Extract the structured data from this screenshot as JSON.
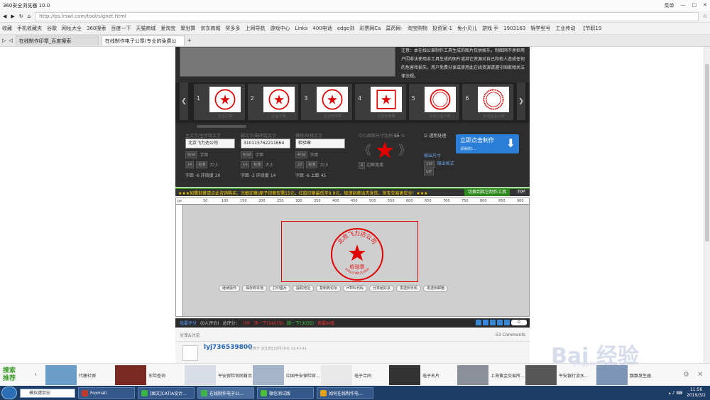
{
  "window": {
    "title": "360安全浏览器 10.0",
    "controls": [
      "菜单"
    ]
  },
  "address": {
    "url": "http://ps.lrswl.com/tool/signet.html"
  },
  "bookmarks": [
    "收藏",
    "手机收藏夹",
    "谷歌",
    "网址大全",
    "360搜索",
    "百度一下",
    "天猫商城",
    "爱淘宝",
    "聚划算",
    "京东商城",
    "奖多多",
    "上网导航",
    "游戏中心",
    "Links",
    "400电话",
    "edge浏",
    "彩票网Ca",
    "莫芮网-",
    "淘宝购物",
    "投资家-1",
    "免小贝儿",
    "游戏 手",
    "1903163",
    "锦学型号",
    "工业传动",
    "【节职19"
  ],
  "tabs": [
    {
      "label": "在线制作印章_百度搜索"
    },
    {
      "label": "在线制作电子公章(专业的免费公"
    }
  ],
  "site": {
    "notice": "注意：本在线公章制作工具生成的图片仅供娱乐，制图网不承担用户因非法使用本工具生成的图片或其它资源对自己和他人造成任何的危害和损失。用户免费分享或使用此在线资源请遵守国家相关法律法规。",
    "templates": [
      {
        "num": "1",
        "label": "企业公章"
      },
      {
        "num": "2",
        "label": "企业公章"
      },
      {
        "num": "3",
        "label": "企业专用章"
      },
      {
        "num": "4",
        "label": "企业专用章"
      },
      {
        "num": "5",
        "label": "外资企业公章"
      },
      {
        "num": "6",
        "label": "外资企业公章"
      }
    ],
    "field1": {
      "caption": "主文字/主环绕文字",
      "value": "北京飞力达公司",
      "font": "Arial",
      "size": "24",
      "style": "标准",
      "spacing_label": "字距",
      "size_label": "大小",
      "stats": "字距 -6   环绕度 20"
    },
    "field2": {
      "caption": "副文字/副环绕文字",
      "value": "310115762211664",
      "font": "Arial",
      "size": "14",
      "style": "标准",
      "spacing_label": "字距",
      "size_label": "大小",
      "stats": "字距 -2   环绕度 14"
    },
    "field3": {
      "caption": "横排/纵排文字",
      "value": "检验章",
      "font": "Arial",
      "size": "22",
      "style": "标准",
      "spacing_label": "字距",
      "size_label": "大小",
      "stats": "字距 -6   上距 45"
    },
    "center": {
      "caption": "中心图案尺寸比例",
      "value": "55",
      "unit": "%",
      "border": "4",
      "border_label": "边框宽度"
    },
    "options": {
      "checkbox": "透明处理",
      "size_label": "输出尺寸",
      "size_value": "150",
      "format_label": "输出格式",
      "format_value": "GIF"
    },
    "make_button": {
      "label": "立即点击制作",
      "sub": "请稍候1..."
    },
    "promo": "★★★如需刻章请点此咨询购买。光敏印章/原子印章仅需15元，红胶印章最低至9.9元，极速刻章当天发货。淘宝交易更安全！★★★",
    "switch_button": "切换到其它制作工具",
    "top_label": "TOP",
    "ruler_ticks": [
      "px",
      "50",
      "100",
      "150",
      "200",
      "250",
      "300",
      "350",
      "400",
      "450",
      "500",
      "550",
      "600",
      "650",
      "700",
      "750",
      "800",
      "850",
      "900"
    ],
    "stamp": {
      "main": "北京飞力达公司",
      "sub": "310115762211664",
      "center": "检验章",
      "color": "#e00000"
    },
    "actions": [
      "继续操作",
      "保存到本地",
      "打印图片",
      "提取地址",
      "复制到论坛",
      "HTML代码",
      "分享给好友",
      "发送到手机",
      "发送到邮箱"
    ],
    "rating": {
      "label": "我要评分",
      "count": "(0人评价)",
      "total_label": "总评分：",
      "total": "0分",
      "up": "顶一下(34079)",
      "down": "踩一下(3035)",
      "report": "我要纠错",
      "share_count": "0"
    },
    "comments": {
      "title": "分享&讨论",
      "count": "53 Comments",
      "user": "lyj736539800",
      "meta": "发表于 2018年10月16日 21:43:41"
    }
  },
  "ads": {
    "label": "搜索推荐",
    "items": [
      "代缴社保",
      "车险查询",
      "平安保险官网首页",
      "中国平安保险官...",
      "电子合同",
      "电子名片",
      "上海黄金交易所...",
      "平安银行流水...",
      "飘飘发生器"
    ]
  },
  "watermark": {
    "main": "Bai 经验",
    "sub": "jingyan.baidu.com"
  },
  "taskbar": {
    "search": "模拟键鼠宏",
    "tasks": [
      "Foxmail",
      "[图文]CATIA设计...",
      "在线制作电子公...",
      "微信测试版",
      "如何在线制作电..."
    ],
    "time": "11:56",
    "date": "2019/3/2"
  }
}
